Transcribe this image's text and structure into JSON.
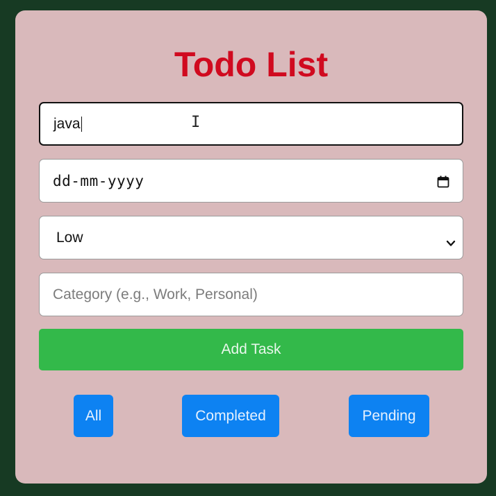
{
  "app": {
    "title": "Todo List"
  },
  "form": {
    "task_input_value": "java",
    "date_placeholder": "dd-mm-yyyy",
    "priority_selected": "Low",
    "category_placeholder": "Category (e.g., Work, Personal)",
    "add_button_label": "Add Task"
  },
  "filters": [
    {
      "label": "All"
    },
    {
      "label": "Completed"
    },
    {
      "label": "Pending"
    }
  ],
  "icons": {
    "calendar": "calendar-icon",
    "select_arrow": "chevron-down-icon",
    "cursor": "text-cursor-icon"
  },
  "colors": {
    "page_background": "#173a23",
    "card_background": "#d9b9bb",
    "title": "#d00a1f",
    "add_button": "#33b94a",
    "filter_buttons": "#0d82f2"
  }
}
